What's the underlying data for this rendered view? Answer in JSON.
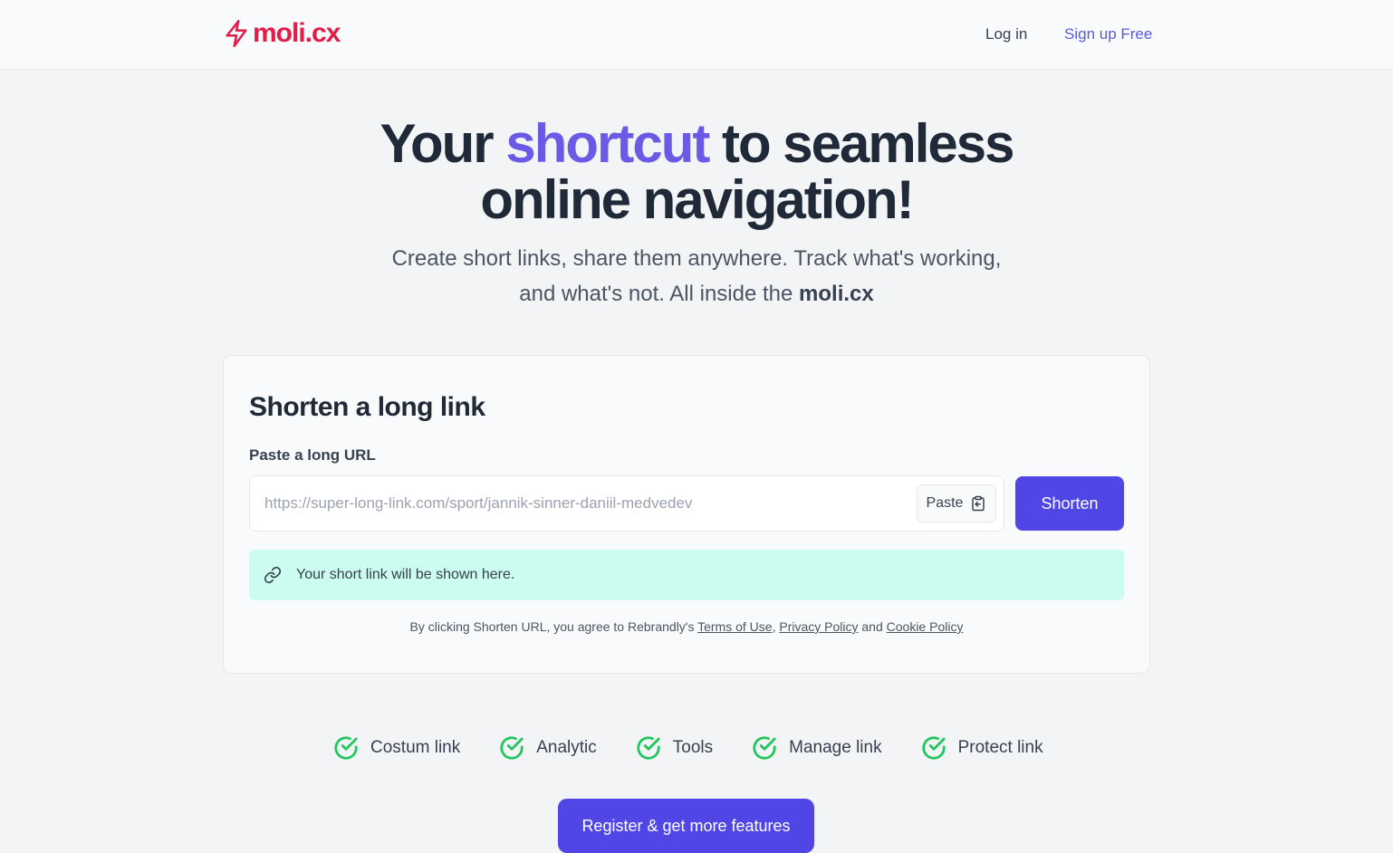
{
  "nav": {
    "logo_text": "moli.cx",
    "login_label": "Log in",
    "signup_label": "Sign up Free"
  },
  "hero": {
    "title_part1": "Your ",
    "title_accent": "shortcut",
    "title_part2": " to seamless",
    "title_line2": "online navigation!",
    "subtitle": "Create short links, share them anywhere. Track what's working, and what's not. All inside the ",
    "subtitle_brand": "moli.cx"
  },
  "card": {
    "title": "Shorten a long link",
    "label": "Paste a long URL",
    "url_placeholder": "https://super-long-link.com/sport/jannik-sinner-daniil-medvedev",
    "paste_label": "Paste",
    "shorten_label": "Shorten",
    "result_text": "Your short link will be shown here.",
    "terms_prefix": "By clicking Shorten URL, you agree to Rebrandly's ",
    "terms_of_use": "Terms of Use",
    "comma": ",",
    "privacy_policy": "Privacy Policy",
    "and": " and ",
    "cookie_policy": "Cookie Policy"
  },
  "features": [
    {
      "label": "Costum link",
      "icon": "check-circle-icon"
    },
    {
      "label": "Analytic",
      "icon": "check-circle-icon"
    },
    {
      "label": "Tools",
      "icon": "check-circle-icon"
    },
    {
      "label": "Manage link",
      "icon": "check-circle-icon"
    },
    {
      "label": "Protect link",
      "icon": "check-circle-icon"
    }
  ],
  "register_label": "Register & get more features",
  "colors": {
    "brand": "#e11d48",
    "accent": "#6b5ae6",
    "primary_button": "#4f46e5",
    "result_bg": "#ccfbef",
    "check_green": "#22c55e"
  }
}
